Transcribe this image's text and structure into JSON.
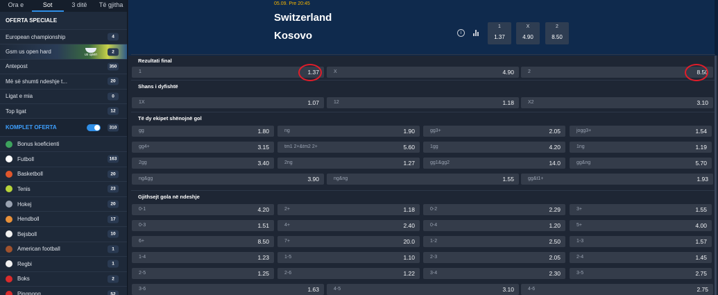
{
  "tabs": [
    {
      "label": "Ora e",
      "active": false
    },
    {
      "label": "Sot",
      "active": true
    },
    {
      "label": "3 ditë",
      "active": false
    },
    {
      "label": "Të gjitha",
      "active": false
    }
  ],
  "oferta_speciale": {
    "title": "OFERTA SPECIALE",
    "items": [
      {
        "label": "European championship",
        "count": "4"
      },
      {
        "label": "Gsm us open hard",
        "count": "2"
      },
      {
        "label": "Antepost",
        "count": "350"
      },
      {
        "label": "Më së shumti ndeshje t...",
        "count": "20"
      },
      {
        "label": "Ligat e mia",
        "count": "0"
      },
      {
        "label": "Top ligat",
        "count": "12"
      }
    ],
    "usopen_logo_text": "us open"
  },
  "komplet": {
    "label": "KOMPLET OFERTA",
    "count": "310"
  },
  "sports": [
    {
      "label": "Bonus koeficienti",
      "count": "",
      "color": "#3da35d"
    },
    {
      "label": "Futboll",
      "count": "163",
      "color": "#ffffff"
    },
    {
      "label": "Basketboll",
      "count": "20",
      "color": "#e0562b"
    },
    {
      "label": "Tenis",
      "count": "23",
      "color": "#b7d43a"
    },
    {
      "label": "Hokej",
      "count": "20",
      "color": "#9aa3b2"
    },
    {
      "label": "Hendboll",
      "count": "17",
      "color": "#e8903a"
    },
    {
      "label": "Bejsboll",
      "count": "10",
      "color": "#f2f2f2"
    },
    {
      "label": "American football",
      "count": "1",
      "color": "#a0522d"
    },
    {
      "label": "Regbi",
      "count": "1",
      "color": "#f2f2f2"
    },
    {
      "label": "Boks",
      "count": "2",
      "color": "#d92b2b"
    },
    {
      "label": "Pingpong",
      "count": "52",
      "color": "#d92b2b"
    }
  ],
  "match": {
    "date": "05.09. Pre 20:45",
    "team1": "Switzerland",
    "team2": "Kosovo",
    "info_icon": "i",
    "odds": [
      {
        "k": "1",
        "v": "1.37"
      },
      {
        "k": "X",
        "v": "4.90"
      },
      {
        "k": "2",
        "v": "8.50"
      }
    ]
  },
  "sections": {
    "rezultati": {
      "title": "Rezultati final",
      "cells": [
        {
          "k": "1",
          "v": "1.37"
        },
        {
          "k": "X",
          "v": "4.90"
        },
        {
          "k": "2",
          "v": "8.50"
        }
      ]
    },
    "shans": {
      "title": "Shans i dyfishtë",
      "cells": [
        {
          "k": "1X",
          "v": "1.07"
        },
        {
          "k": "12",
          "v": "1.18"
        },
        {
          "k": "X2",
          "v": "3.10"
        }
      ]
    },
    "teDy": {
      "title": "Të dy ekipet shënojnë gol",
      "rows": [
        [
          {
            "k": "gg",
            "v": "1.80"
          },
          {
            "k": "ng",
            "v": "1.90"
          },
          {
            "k": "gg3+",
            "v": "2.05"
          },
          {
            "k": "jogg3+",
            "v": "1.54"
          }
        ],
        [
          {
            "k": "gg4+",
            "v": "3.15"
          },
          {
            "k": "tm1 2+&tm2 2+",
            "v": "5.60"
          },
          {
            "k": "1gg",
            "v": "4.20"
          },
          {
            "k": "1ng",
            "v": "1.19"
          }
        ],
        [
          {
            "k": "2gg",
            "v": "3.40"
          },
          {
            "k": "2ng",
            "v": "1.27"
          },
          {
            "k": "gg1&gg2",
            "v": "14.0"
          },
          {
            "k": "gg&ng",
            "v": "5.70"
          }
        ],
        [
          {
            "k": "ng&gg",
            "v": "3.90"
          },
          {
            "k": "ng&ng",
            "v": "1.55"
          },
          {
            "k": "gg&t1+",
            "v": "1.93"
          }
        ]
      ]
    },
    "gjithsejt": {
      "title": "Gjithsejt gola në ndeshje",
      "rows": [
        [
          {
            "k": "0-1",
            "v": "4.20"
          },
          {
            "k": "2+",
            "v": "1.18"
          },
          {
            "k": "0-2",
            "v": "2.29"
          },
          {
            "k": "3+",
            "v": "1.55"
          }
        ],
        [
          {
            "k": "0-3",
            "v": "1.51"
          },
          {
            "k": "4+",
            "v": "2.40"
          },
          {
            "k": "0-4",
            "v": "1.20"
          },
          {
            "k": "5+",
            "v": "4.00"
          }
        ],
        [
          {
            "k": "6+",
            "v": "8.50"
          },
          {
            "k": "7+",
            "v": "20.0"
          },
          {
            "k": "1-2",
            "v": "2.50"
          },
          {
            "k": "1-3",
            "v": "1.57"
          }
        ],
        [
          {
            "k": "1-4",
            "v": "1.23"
          },
          {
            "k": "1-5",
            "v": "1.10"
          },
          {
            "k": "2-3",
            "v": "2.05"
          },
          {
            "k": "2-4",
            "v": "1.45"
          }
        ],
        [
          {
            "k": "2-5",
            "v": "1.25"
          },
          {
            "k": "2-6",
            "v": "1.22"
          },
          {
            "k": "3-4",
            "v": "2.30"
          },
          {
            "k": "3-5",
            "v": "2.75"
          }
        ],
        [
          {
            "k": "3-6",
            "v": "1.63"
          },
          {
            "k": "4-5",
            "v": "3.10"
          },
          {
            "k": "4-6",
            "v": "2.75"
          }
        ]
      ]
    }
  },
  "colors": {
    "accent": "#2f8fe8",
    "header_bg": "#0f2a4d",
    "highlight": "#e11d2a",
    "date": "#f4b400"
  }
}
